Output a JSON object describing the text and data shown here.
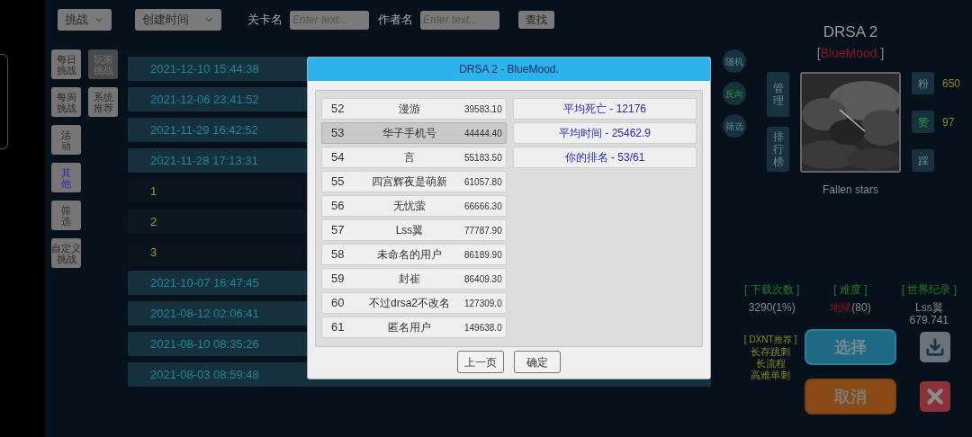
{
  "filters": {
    "mode_dropdown": "挑战",
    "sort_dropdown": "创建时间",
    "level_label": "关卡名",
    "level_placeholder": "Enter text...",
    "author_label": "作者名",
    "author_placeholder": "Enter text...",
    "search_button": "查找"
  },
  "nav": {
    "left_column": [
      {
        "label": "每日挑战",
        "selected": false
      },
      {
        "label": "每周挑战",
        "selected": false
      },
      {
        "label": "活动",
        "selected": false
      },
      {
        "label": "其他",
        "selected": true
      },
      {
        "label": "筛选",
        "selected": false
      },
      {
        "label": "自定义挑战",
        "selected": false
      }
    ],
    "right_column": [
      {
        "label": "玩家挑战",
        "selected": true
      },
      {
        "label": "系统推荐",
        "selected": false
      }
    ]
  },
  "list": [
    {
      "kind": "date",
      "text": "2021-12-10 15:44:38"
    },
    {
      "kind": "date",
      "text": "2021-12-06 23:41:52"
    },
    {
      "kind": "date",
      "text": "2021-11-29 16:42:52"
    },
    {
      "kind": "date",
      "text": "2021-11-28 17:13:31"
    },
    {
      "kind": "number",
      "text": "1"
    },
    {
      "kind": "number",
      "text": "2"
    },
    {
      "kind": "number",
      "text": "3"
    },
    {
      "kind": "date",
      "text": "2021-10-07 16:47:45"
    },
    {
      "kind": "date",
      "text": "2021-08-12 02:06:41"
    },
    {
      "kind": "date",
      "text": "2021-08-10 08:35:26"
    },
    {
      "kind": "date",
      "text": "2021-08-03 08:59:48"
    }
  ],
  "side_toggles": [
    {
      "label": "随机",
      "on": false
    },
    {
      "label": "反向",
      "on": true
    },
    {
      "label": "筛选",
      "on": false
    }
  ],
  "level_panel": {
    "title": "DRSA 2",
    "author": "BlueMood.",
    "author_open": "[",
    "author_close": "]",
    "side_buttons": [
      "管理",
      "排行榜"
    ],
    "reactions": [
      {
        "label": "粉",
        "on": false,
        "count": "650"
      },
      {
        "label": "赞",
        "on": true,
        "count": "97"
      },
      {
        "label": "踩",
        "on": false
      }
    ],
    "level_name": "Fallen stars",
    "stats": [
      {
        "heading": "[ 下载次数 ]",
        "lines": [
          "3290(1%)"
        ]
      },
      {
        "heading": "[ 难度 ]",
        "difficulty": "地狱",
        "lines": [
          "(80)"
        ]
      },
      {
        "heading": "[ 世界纪录 ]",
        "lines": [
          "Lss翼",
          "679.741"
        ]
      }
    ],
    "recommend": {
      "heading": "[ DXNT推荐 ]",
      "tags": [
        "长存跳刺",
        "长流程",
        "高难单刺"
      ]
    },
    "select_button": "选择",
    "cancel_button": "取消"
  },
  "dialog": {
    "title": "DRSA 2 - BlueMood.",
    "ranking": [
      {
        "rank": "52",
        "name": "漫游",
        "score": "39583.10",
        "selected": false
      },
      {
        "rank": "53",
        "name": "华子手机号",
        "score": "44444.40",
        "selected": true
      },
      {
        "rank": "54",
        "name": "言",
        "score": "55183.50",
        "selected": false
      },
      {
        "rank": "55",
        "name": "四宫辉夜是萌新",
        "score": "61057.80",
        "selected": false
      },
      {
        "rank": "56",
        "name": "无忧萤",
        "score": "66666.30",
        "selected": false
      },
      {
        "rank": "57",
        "name": "Lss翼",
        "score": "77787.90",
        "selected": false
      },
      {
        "rank": "58",
        "name": "未命名的用户",
        "score": "86189.90",
        "selected": false
      },
      {
        "rank": "59",
        "name": "封崔",
        "score": "86409.30",
        "selected": false
      },
      {
        "rank": "60",
        "name": "不过drsa2不改名",
        "score": "127309.0",
        "selected": false
      },
      {
        "rank": "61",
        "name": "匿名用户",
        "score": "149638.0",
        "selected": false
      }
    ],
    "summary": [
      "平均死亡 - 12176",
      "平均时间 - 25462.9",
      "你的排名 - 53/61"
    ],
    "buttons": [
      "上一页",
      "确定"
    ]
  }
}
